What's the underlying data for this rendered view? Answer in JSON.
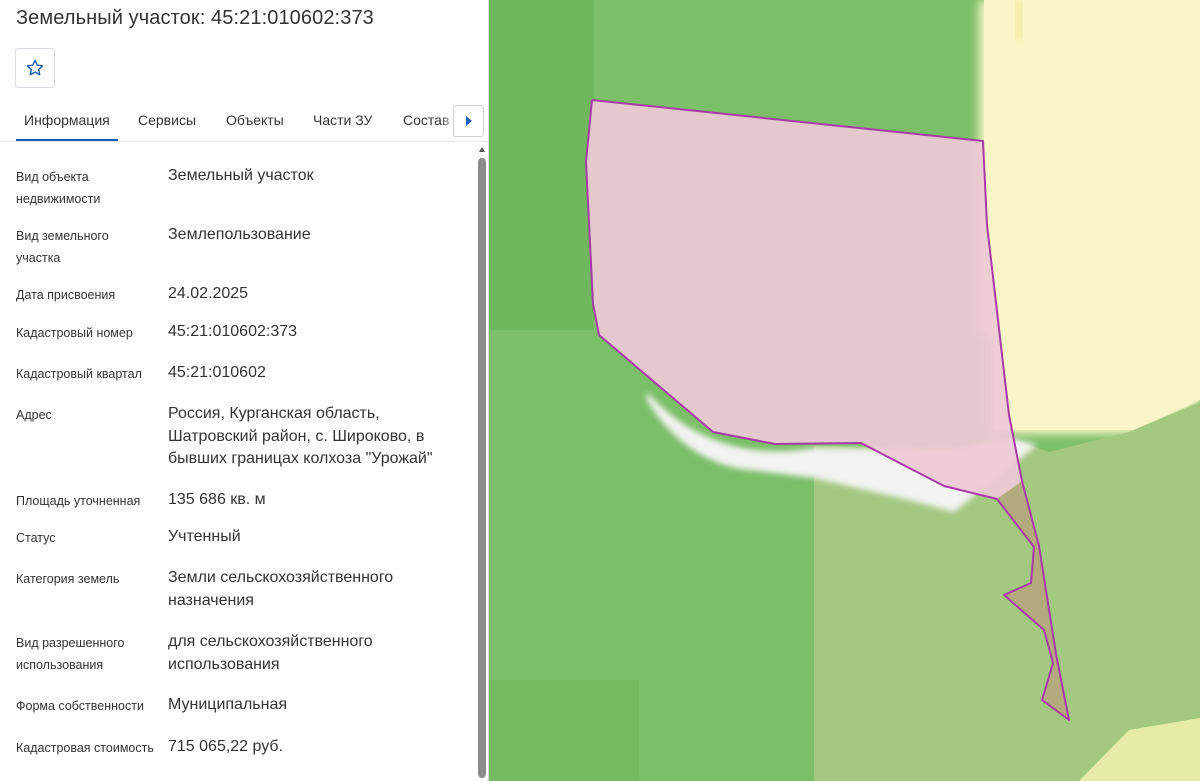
{
  "panel": {
    "title": "Земельный участок: 45:21:010602:373",
    "favorite_icon": "star-outline-icon",
    "tabs": [
      {
        "label": "Информация",
        "active": true
      },
      {
        "label": "Сервисы",
        "active": false
      },
      {
        "label": "Объекты",
        "active": false
      },
      {
        "label": "Части ЗУ",
        "active": false
      },
      {
        "label": "Состав",
        "active": false
      }
    ],
    "tabs_next_icon": "caret-right-icon",
    "rows": [
      {
        "label": "Вид объекта недвижимости",
        "value": "Земельный участок"
      },
      {
        "label": "Вид земельного участка",
        "value": "Землепользование"
      },
      {
        "label": "Дата присвоения",
        "value": "24.02.2025"
      },
      {
        "label": "Кадастровый номер",
        "value": "45:21:010602:373"
      },
      {
        "label": "Кадастровый квартал",
        "value": "45:21:010602"
      },
      {
        "label": "Адрес",
        "value": "Россия, Курганская область, Шатровский район, с. Широково, в бывших границах колхоза \"Урожай\""
      },
      {
        "label": "Площадь уточненная",
        "value": "135 686 кв. м"
      },
      {
        "label": "Статус",
        "value": "Учтенный"
      },
      {
        "label": "Категория земель",
        "value": "Земли сельскохозяйственного назначения"
      },
      {
        "label": "Вид разрешенного использования",
        "value": "для сельскохозяйственного использования"
      },
      {
        "label": "Форма собственности",
        "value": "Муниципальная"
      },
      {
        "label": "Кадастровая стоимость",
        "value": "715 065,22 руб."
      }
    ]
  },
  "colors": {
    "accent": "#1a5fb4",
    "parcel_outline": "#a83aa8",
    "parcel_fill": "#eec9d6",
    "forest": "#7bbf69",
    "field": "#a3c981",
    "settlement": "#faf5c6",
    "road": "#f3f3f1"
  }
}
